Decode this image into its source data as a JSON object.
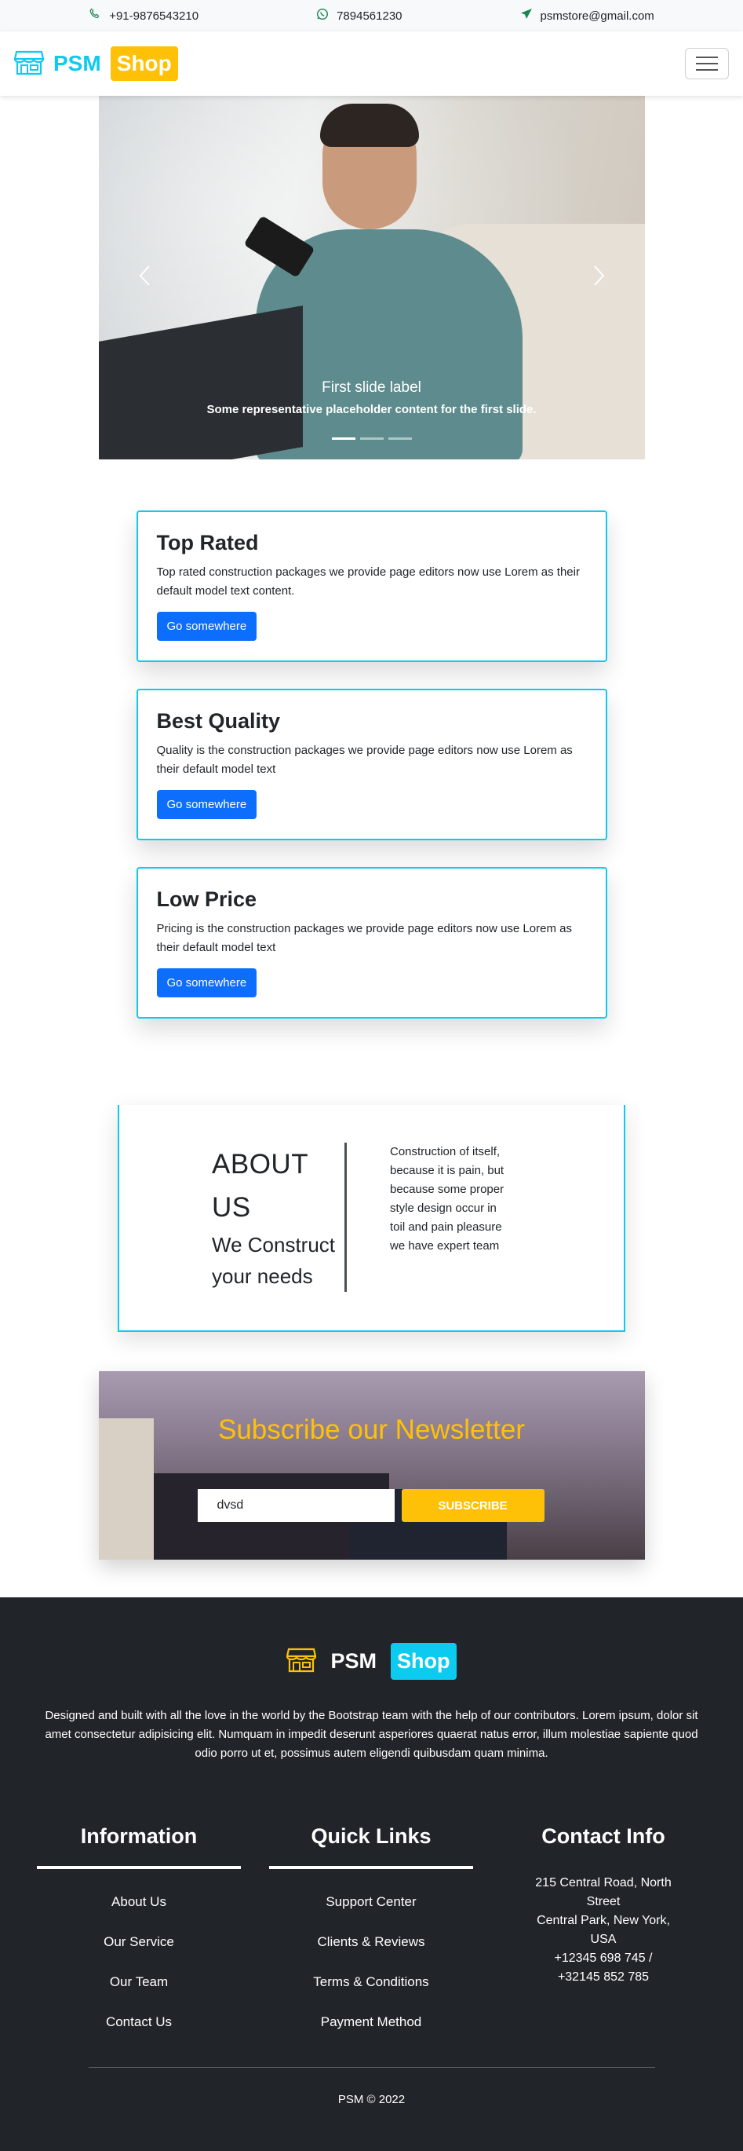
{
  "topbar": {
    "phone": "+91-9876543210",
    "whatsapp": "7894561230",
    "email": "psmstore@gmail.com"
  },
  "navbar": {
    "brand_psm": "PSM",
    "brand_shop": "Shop"
  },
  "carousel": {
    "caption_label": "First slide label",
    "caption_text": "Some representative placeholder content for the first slide.",
    "slide_count": 3,
    "active_slide": 1
  },
  "cards": [
    {
      "title": "Top Rated",
      "text": "Top rated construction packages we provide page editors now use Lorem as their default model text content.",
      "button": "Go somewhere"
    },
    {
      "title": "Best Quality",
      "text": "Quality is the construction packages we provide page editors now use Lorem as their default model text",
      "button": "Go somewhere"
    },
    {
      "title": "Low Price",
      "text": "Pricing is the construction packages we provide page editors now use Lorem as their default model text",
      "button": "Go somewhere"
    }
  ],
  "about": {
    "title": "ABOUT US",
    "subtitle": "We Construct your needs",
    "text": "Construction of itself, because it is pain, but because some proper style design occur in toil and pain pleasure we have expert team"
  },
  "newsletter": {
    "heading": "Subscribe our Newsletter",
    "input_value": "dvsd",
    "button": "SUBSCRIBE"
  },
  "footer": {
    "brand_psm": "PSM",
    "brand_shop": "Shop",
    "description": "Designed and built with all the love in the world by the Bootstrap team with the help of our contributors. Lorem ipsum, dolor sit amet consectetur adipisicing elit. Numquam in impedit deserunt asperiores quaerat natus error, illum molestiae sapiente quod odio porro ut et, possimus autem eligendi quibusdam quam minima.",
    "information": {
      "heading": "Information",
      "links": [
        "About Us",
        "Our Service",
        "Our Team",
        "Contact Us"
      ]
    },
    "quick_links": {
      "heading": "Quick Links",
      "links": [
        "Support Center",
        "Clients & Reviews",
        "Terms & Conditions",
        "Payment Method"
      ]
    },
    "contact": {
      "heading": "Contact Info",
      "address1": "215 Central Road, North Street",
      "address2": "Central Park, New York, USA",
      "phones": "+12345 698 745 / +32145 852 785"
    },
    "copyright": "PSM © 2022"
  },
  "colors": {
    "accent_cyan": "#0dcaf0",
    "accent_yellow": "#ffc107",
    "primary_blue": "#0d6efd",
    "footer_bg": "#212529"
  }
}
